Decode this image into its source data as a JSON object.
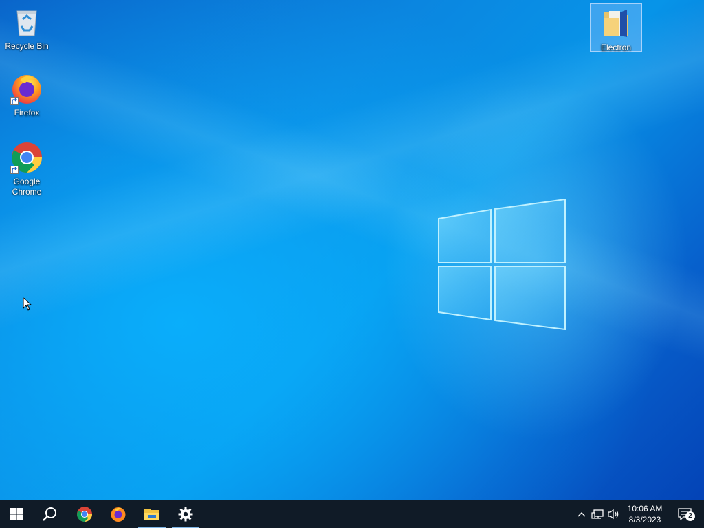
{
  "desktop": {
    "icons": [
      {
        "label": "Recycle Bin",
        "icon": "recycle-bin-icon"
      },
      {
        "label": "Firefox",
        "icon": "firefox-icon"
      },
      {
        "label": "Google\nChrome",
        "icon": "chrome-icon"
      },
      {
        "label": "Electron",
        "icon": "folder-icon",
        "selected": true
      }
    ],
    "wallpaper": "windows-10-hero",
    "colors": {
      "wallpaper_light": "#0a9cf0",
      "wallpaper_dark": "#0443b6"
    }
  },
  "taskbar": {
    "buttons": [
      {
        "name": "start",
        "icon": "windows-start-icon"
      },
      {
        "name": "search",
        "icon": "search-icon"
      },
      {
        "name": "chrome",
        "icon": "chrome-icon"
      },
      {
        "name": "firefox",
        "icon": "firefox-icon"
      },
      {
        "name": "file-explorer",
        "icon": "file-explorer-icon",
        "active": true
      },
      {
        "name": "settings",
        "icon": "gear-icon",
        "active": true
      }
    ],
    "tray": {
      "time": "10:06 AM",
      "date": "8/3/2023",
      "notifications_count": "2",
      "icons": [
        "chevron-up-icon",
        "network-icon",
        "volume-icon",
        "action-center-icon"
      ]
    },
    "color": "#101b27"
  }
}
